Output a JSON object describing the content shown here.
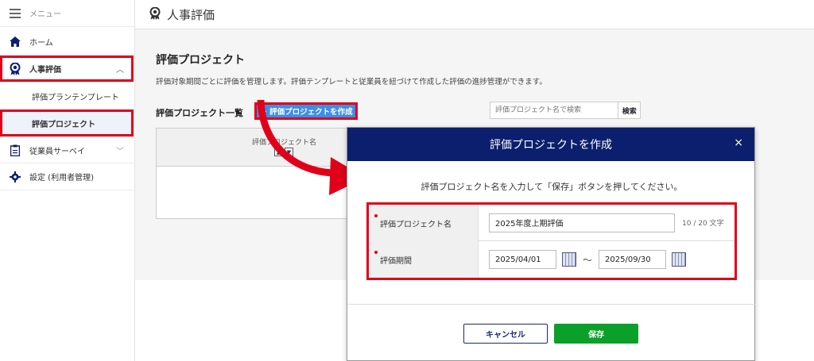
{
  "sidebar": {
    "menu_label": "メニュー",
    "items": [
      {
        "label": "ホーム",
        "icon": "home-icon"
      },
      {
        "label": "人事評価",
        "icon": "award-icon"
      },
      {
        "label": "評価プランテンプレート"
      },
      {
        "label": "評価プロジェクト"
      },
      {
        "label": "従業員サーベイ",
        "icon": "clipboard-icon"
      },
      {
        "label": "設定 (利用者管理)",
        "icon": "gear-icon"
      }
    ]
  },
  "topbar": {
    "title": "人事評価"
  },
  "main": {
    "heading": "評価プロジェクト",
    "description": "評価対象期間ごとに評価を管理します。評価テンプレートと従業員を紐づけて作成した評価の進捗管理ができます。",
    "list_heading": "評価プロジェクト一覧",
    "create_button": "＋ 評価プロジェクトを作成",
    "search_placeholder": "評価プロジェクト名で検索",
    "search_button": "検索",
    "table_header": "評価プロジェクト名"
  },
  "modal": {
    "title": "評価プロジェクトを作成",
    "close": "×",
    "instruction": "評価プロジェクト名を入力して「保存」ボタンを押してください。",
    "name_label": "評価プロジェクト名",
    "name_value": "2025年度上期評価",
    "name_count": "10 / 20 文字",
    "period_label": "評価期間",
    "start_date": "2025/04/01",
    "end_date": "2025/09/30",
    "tilde": "～",
    "cancel_button": "キャンセル",
    "save_button": "保存"
  },
  "colors": {
    "accent_red": "#e0001a",
    "modal_header": "#0b1f6e",
    "save_green": "#0aa02a",
    "primary_blue": "#3b8fe8"
  }
}
